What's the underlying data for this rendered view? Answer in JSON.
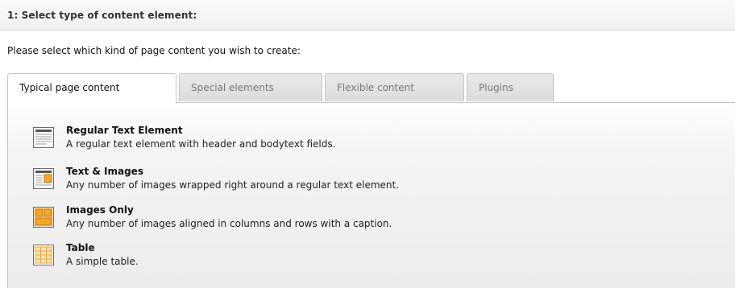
{
  "section": {
    "title": "1: Select type of content element:"
  },
  "intro_text": "Please select which kind of page content you wish to create:",
  "tabs": [
    {
      "label": "Typical page content",
      "active": true
    },
    {
      "label": "Special elements",
      "active": false
    },
    {
      "label": "Flexible content",
      "active": false
    },
    {
      "label": "Plugins",
      "active": false
    }
  ],
  "elements": [
    {
      "title": "Regular Text Element",
      "description": "A regular text element with header and bodytext fields.",
      "icon": "text-element-icon"
    },
    {
      "title": "Text & Images",
      "description": "Any number of images wrapped right around a regular text element.",
      "icon": "text-images-icon"
    },
    {
      "title": "Images Only",
      "description": "Any number of images aligned in columns and rows with a caption.",
      "icon": "images-only-icon"
    },
    {
      "title": "Table",
      "description": "A simple table.",
      "icon": "table-icon"
    }
  ],
  "colors": {
    "icon_orange": "#f5a623",
    "icon_border": "#6b6b6b",
    "tab_border": "#c4c4c4"
  }
}
